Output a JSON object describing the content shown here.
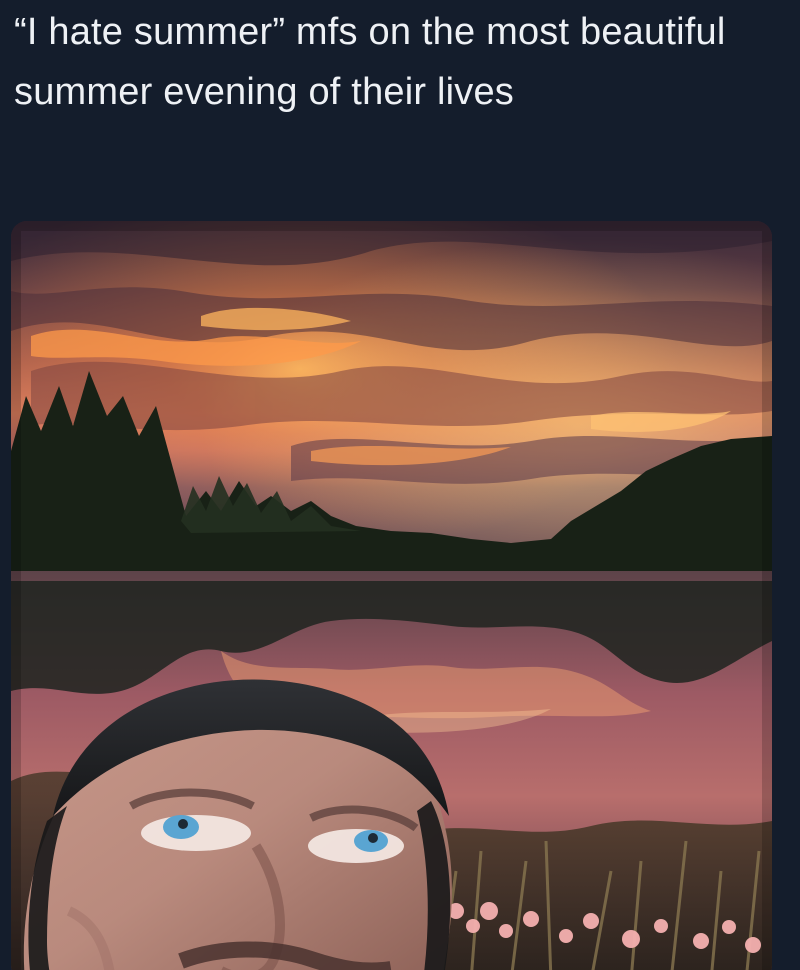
{
  "tweet": {
    "text": "“I hate summer” mfs on the most beautiful summer evening of their lives"
  },
  "media": {
    "scene": "sunset-lake-meme",
    "colors": {
      "background": "#141d2c",
      "text": "#eef1f5",
      "sky_top": "#3a2a3a",
      "sky_glow": "#f08a3c",
      "water": "#6d3f4a",
      "trees": "#1a2418"
    }
  }
}
